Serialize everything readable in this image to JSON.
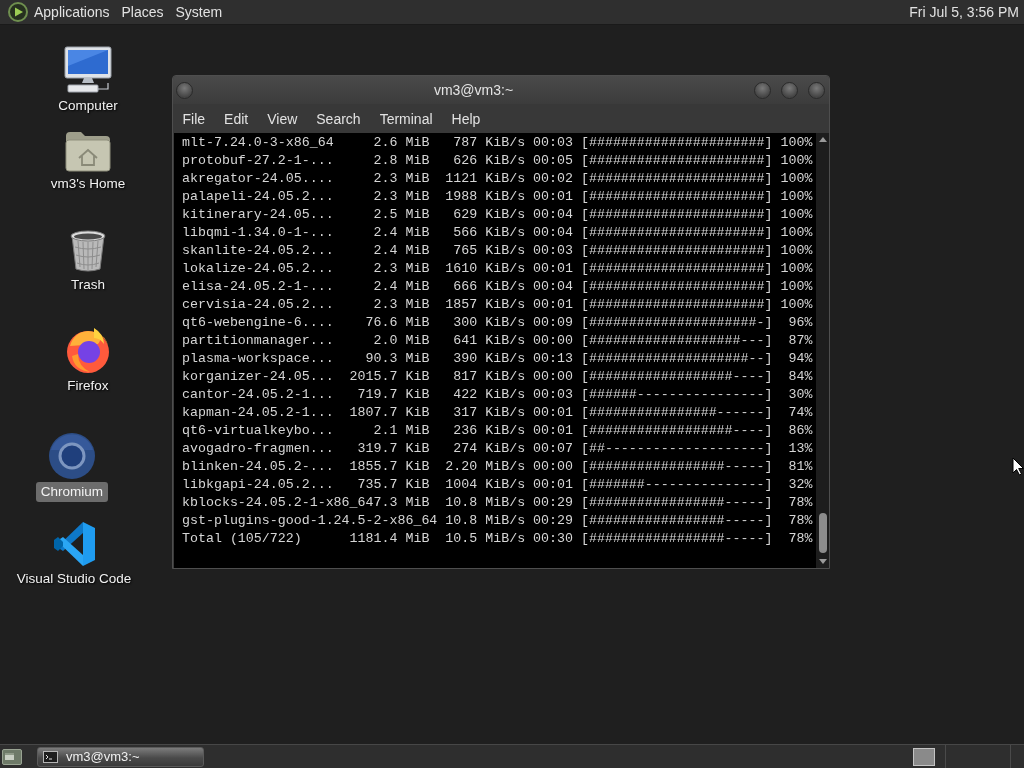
{
  "top_panel": {
    "menus": [
      "Applications",
      "Places",
      "System"
    ],
    "clock": "Fri Jul 5, 3:56 PM"
  },
  "desktop_icons": [
    {
      "kind": "computer",
      "label": "Computer",
      "selected": false
    },
    {
      "kind": "home",
      "label": "vm3's Home",
      "selected": false
    },
    {
      "kind": "trash",
      "label": "Trash",
      "selected": false
    },
    {
      "kind": "firefox",
      "label": "Firefox",
      "selected": false
    },
    {
      "kind": "chromium",
      "label": "Chromium",
      "selected": true
    },
    {
      "kind": "vscode",
      "label": "Visual Studio Code",
      "selected": false
    }
  ],
  "terminal_window": {
    "title": "vm3@vm3:~",
    "menu": [
      "File",
      "Edit",
      "View",
      "Search",
      "Terminal",
      "Help"
    ],
    "lines": [
      "mlt-7.24.0-3-x86_64     2.6 MiB   787 KiB/s 00:03 [######################] 100%",
      "protobuf-27.2-1-...     2.8 MiB   626 KiB/s 00:05 [######################] 100%",
      "akregator-24.05....     2.3 MiB  1121 KiB/s 00:02 [######################] 100%",
      "palapeli-24.05.2...     2.3 MiB  1988 KiB/s 00:01 [######################] 100%",
      "kitinerary-24.05...     2.5 MiB   629 KiB/s 00:04 [######################] 100%",
      "libqmi-1.34.0-1-...     2.4 MiB   566 KiB/s 00:04 [######################] 100%",
      "skanlite-24.05.2...     2.4 MiB   765 KiB/s 00:03 [######################] 100%",
      "lokalize-24.05.2...     2.3 MiB  1610 KiB/s 00:01 [######################] 100%",
      "elisa-24.05.2-1-...     2.4 MiB   666 KiB/s 00:04 [######################] 100%",
      "cervisia-24.05.2...     2.3 MiB  1857 KiB/s 00:01 [######################] 100%",
      "qt6-webengine-6....    76.6 MiB   300 KiB/s 00:09 [#####################-]  96%",
      "partitionmanager...     2.0 MiB   641 KiB/s 00:00 [###################---]  87%",
      "plasma-workspace...    90.3 MiB   390 KiB/s 00:13 [####################--]  94%",
      "korganizer-24.05...  2015.7 KiB   817 KiB/s 00:00 [##################----]  84%",
      "cantor-24.05.2-1...   719.7 KiB   422 KiB/s 00:03 [######----------------]  30%",
      "kapman-24.05.2-1...  1807.7 KiB   317 KiB/s 00:01 [################------]  74%",
      "qt6-virtualkeybo...     2.1 MiB   236 KiB/s 00:01 [##################----]  86%",
      "avogadro-fragmen...   319.7 KiB   274 KiB/s 00:07 [##--------------------]  13%",
      "blinken-24.05.2-...  1855.7 KiB  2.20 MiB/s 00:00 [#################-----]  81%",
      "libkgapi-24.05.2...   735.7 KiB  1004 KiB/s 00:01 [#######---------------]  32%",
      "kblocks-24.05.2-1-x86_647.3 MiB  10.8 MiB/s 00:29 [#################-----]  78%",
      "gst-plugins-good-1.24.5-2-x86_64 10.8 MiB/s 00:29 [#################-----]  78%",
      "Total (105/722)      1181.4 MiB  10.5 MiB/s 00:30 [#################-----]  78%"
    ]
  },
  "taskbar": {
    "tasks": [
      {
        "label": "vm3@vm3:~",
        "selected": false
      }
    ]
  }
}
